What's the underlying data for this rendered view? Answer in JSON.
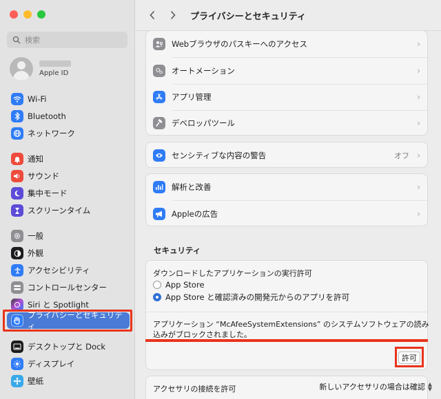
{
  "window": {
    "title": "プライバシーとセキュリティ"
  },
  "sidebar": {
    "search_placeholder": "検索",
    "account_label": "Apple ID",
    "items": [
      {
        "label": "Wi-Fi",
        "icon": "wifi-icon",
        "color": "#2f7cf6"
      },
      {
        "label": "Bluetooth",
        "icon": "bluetooth-icon",
        "color": "#2f7cf6"
      },
      {
        "label": "ネットワーク",
        "icon": "globe-icon",
        "color": "#2f7cf6"
      },
      {
        "label": "通知",
        "icon": "bell-icon",
        "color": "#ee4b3c"
      },
      {
        "label": "サウンド",
        "icon": "speaker-icon",
        "color": "#ee4b3c"
      },
      {
        "label": "集中モード",
        "icon": "moon-icon",
        "color": "#5d4bd8"
      },
      {
        "label": "スクリーンタイム",
        "icon": "hourglass-icon",
        "color": "#5d4bd8"
      },
      {
        "label": "一般",
        "icon": "gear-icon",
        "color": "#8e8e93"
      },
      {
        "label": "外観",
        "icon": "appearance-icon",
        "color": "#1c1c1e"
      },
      {
        "label": "アクセシビリティ",
        "icon": "accessibility-icon",
        "color": "#2f7cf6"
      },
      {
        "label": "コントロールセンター",
        "icon": "control-center-icon",
        "color": "#8e8e93"
      },
      {
        "label": "Siri と Spotlight",
        "icon": "siri-icon",
        "color": "#b04fd6"
      },
      {
        "label": "プライバシーとセキュリティ",
        "icon": "hand-icon",
        "color": "#2f7cf6"
      },
      {
        "label": "デスクトップと Dock",
        "icon": "dock-icon",
        "color": "#1c1c1e"
      },
      {
        "label": "ディスプレイ",
        "icon": "display-icon",
        "color": "#2f7cf6"
      },
      {
        "label": "壁紙",
        "icon": "wallpaper-icon",
        "color": "#39a9e8"
      }
    ]
  },
  "main": {
    "group1": [
      {
        "label": "Webブラウザのパスキーへのアクセス",
        "icon": "passkey-icon",
        "color": "#8e8e93"
      },
      {
        "label": "オートメーション",
        "icon": "gears-icon",
        "color": "#8e8e93"
      },
      {
        "label": "アプリ管理",
        "icon": "app-store-icon",
        "color": "#2f7cf6"
      },
      {
        "label": "デベロッパツール",
        "icon": "hammer-icon",
        "color": "#8e8e93"
      }
    ],
    "sensitive": {
      "label": "センシティブな内容の警告",
      "value": "オフ",
      "icon": "eye-icon",
      "color": "#2f7cf6"
    },
    "group3": [
      {
        "label": "解析と改善",
        "icon": "chart-icon",
        "color": "#2f7cf6"
      },
      {
        "label": "Appleの広告",
        "icon": "megaphone-icon",
        "color": "#2f7cf6"
      }
    ],
    "security": {
      "title": "セキュリティ",
      "download_label": "ダウンロードしたアプリケーションの実行許可",
      "option1": "App Store",
      "option2": "App Store と確認済みの開発元からのアプリを許可",
      "blocked_line1": "アプリケーション “McAfeeSystemExtensions” のシステムソフトウェアの読み",
      "blocked_line2": "込みがブロックされました。",
      "allow_label": "許可"
    },
    "accessory": {
      "label": "アクセサリの接続を許可",
      "value": "新しいアクセサリの場合は確認"
    }
  }
}
